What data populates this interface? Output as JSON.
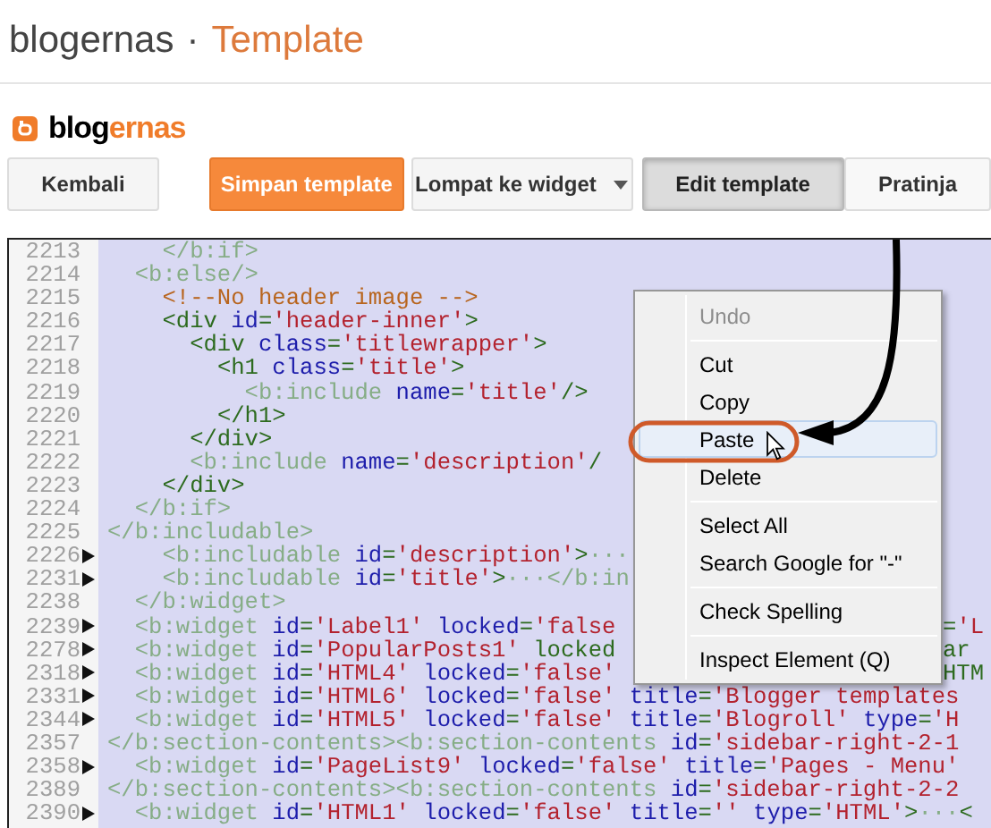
{
  "header": {
    "blog": "blogernas",
    "separator": "·",
    "page": "Template"
  },
  "logo": {
    "main": "blog",
    "accent": "ernas"
  },
  "toolbar": [
    {
      "label": "Kembali",
      "kind": "plain"
    },
    {
      "label": "Simpan template",
      "kind": "primary"
    },
    {
      "label": "Lompat ke widget",
      "kind": "dropdown"
    },
    {
      "label": "Edit template",
      "kind": "tab",
      "selected": true
    },
    {
      "label": "Pratinja",
      "kind": "tab",
      "selected": false
    }
  ],
  "editor": {
    "lines": [
      {
        "number": "2213",
        "folded": false,
        "text": "    </b:if>"
      },
      {
        "number": "2214",
        "folded": false,
        "text": "  <b:else/>"
      },
      {
        "number": "2215",
        "folded": false,
        "text": "    <!--No header image -->"
      },
      {
        "number": "2216",
        "folded": false,
        "text": "    <div id='header-inner'>"
      },
      {
        "number": "2217",
        "folded": false,
        "text": "      <div class='titlewrapper'>"
      },
      {
        "number": "2218",
        "folded": false,
        "text": "        <h1 class='title'>"
      },
      {
        "number": "2219",
        "folded": false,
        "text": "          <b:include name='title'/>"
      },
      {
        "number": "2220",
        "folded": false,
        "text": "        </h1>"
      },
      {
        "number": "2221",
        "folded": false,
        "text": "      </div>"
      },
      {
        "number": "2222",
        "folded": false,
        "text": "      <b:include name='description'/"
      },
      {
        "number": "2223",
        "folded": false,
        "text": "    </div>"
      },
      {
        "number": "2224",
        "folded": false,
        "text": "  </b:if>"
      },
      {
        "number": "2225",
        "folded": false,
        "text": "</b:includable>"
      },
      {
        "number": "2226",
        "folded": true,
        "text": "    <b:includable id='description'>···"
      },
      {
        "number": "2231",
        "folded": true,
        "text": "    <b:includable id='title'>···</b:in"
      },
      {
        "number": "2238",
        "folded": false,
        "text": "  </b:widget>"
      },
      {
        "number": "2239",
        "folded": true,
        "text": "  <b:widget id='Label1' locked='false",
        "right": "='L"
      },
      {
        "number": "2278",
        "folded": true,
        "text": "  <b:widget id='PopularPosts1' locked",
        "right": "ar"
      },
      {
        "number": "2318",
        "folded": true,
        "text": "  <b:widget id='HTML4' locked='false'",
        "right": "HTM"
      },
      {
        "number": "2331",
        "folded": true,
        "text": "  <b:widget id='HTML6' locked='false' title='Blogger templates"
      },
      {
        "number": "2344",
        "folded": true,
        "text": "  <b:widget id='HTML5' locked='false' title='Blogroll' type='H"
      },
      {
        "number": "2357",
        "folded": false,
        "text": "</b:section-contents><b:section-contents id='sidebar-right-2-1"
      },
      {
        "number": "2358",
        "folded": true,
        "text": "  <b:widget id='PageList9' locked='false' title='Pages - Menu'"
      },
      {
        "number": "2389",
        "folded": false,
        "text": "</b:section-contents><b:section-contents id='sidebar-right-2-2"
      },
      {
        "number": "2390",
        "folded": true,
        "text": "  <b:widget id='HTML1' locked='false' title='' type='HTML'>···<"
      }
    ]
  },
  "context_menu": {
    "items": [
      {
        "kind": "item",
        "label": "Undo",
        "disabled": true,
        "selected": false
      },
      {
        "kind": "divider"
      },
      {
        "kind": "item",
        "label": "Cut",
        "disabled": false,
        "selected": false
      },
      {
        "kind": "item",
        "label": "Copy",
        "disabled": false,
        "selected": false
      },
      {
        "kind": "item",
        "label": "Paste",
        "disabled": false,
        "selected": true
      },
      {
        "kind": "item",
        "label": "Delete",
        "disabled": false,
        "selected": false
      },
      {
        "kind": "divider"
      },
      {
        "kind": "item",
        "label": "Select All",
        "disabled": false,
        "selected": false
      },
      {
        "kind": "item",
        "label": "Search Google for \"-\"",
        "disabled": false,
        "selected": false
      },
      {
        "kind": "divider"
      },
      {
        "kind": "item",
        "label": "Check Spelling",
        "disabled": false,
        "selected": false
      },
      {
        "kind": "divider"
      },
      {
        "kind": "item",
        "label": "Inspect Element (Q)",
        "disabled": false,
        "selected": false
      }
    ]
  }
}
